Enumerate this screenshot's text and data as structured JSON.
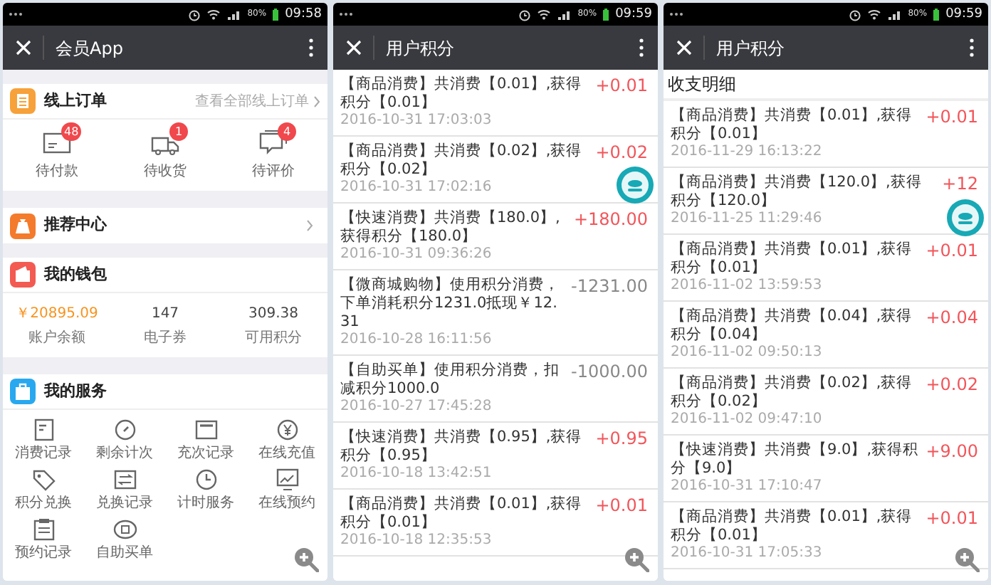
{
  "phones": [
    {
      "kind": "home",
      "status_bar": {
        "time": "09:58",
        "battery": "80%"
      },
      "title_bar": {
        "title": "会员App"
      },
      "orders": {
        "title": "线上订单",
        "link": "查看全部线上订单",
        "items": [
          {
            "label": "待付款",
            "badge": "48"
          },
          {
            "label": "待收货",
            "badge": "1"
          },
          {
            "label": "待评价",
            "badge": "4"
          }
        ]
      },
      "referral": {
        "title": "推荐中心"
      },
      "wallet": {
        "title": "我的钱包",
        "stats": [
          {
            "value": "￥20895.09",
            "label": "账户余额",
            "highlighted": true
          },
          {
            "value": "147",
            "label": "电子券",
            "highlighted": false
          },
          {
            "value": "309.38",
            "label": "可用积分",
            "highlighted": false
          }
        ]
      },
      "services": {
        "title": "我的服务",
        "items": [
          "消费记录",
          "剩余计次",
          "充次记录",
          "在线充值",
          "积分兑换",
          "兑换记录",
          "计时服务",
          "在线预约",
          "预约记录",
          "自助买单"
        ]
      }
    },
    {
      "kind": "points",
      "status_bar": {
        "time": "09:59",
        "battery": "80%"
      },
      "title_bar": {
        "title": "用户积分"
      },
      "entries": [
        {
          "kind": "credit",
          "text": "【商品消费】共消费【0.01】,获得积分【0.01】",
          "date": "2016-10-31 17:03:03",
          "amount": "+0.01"
        },
        {
          "kind": "credit",
          "text": "【商品消费】共消费【0.02】,获得积分【0.02】",
          "date": "2016-10-31 17:02:16",
          "amount": "+0.02"
        },
        {
          "kind": "credit",
          "text": "【快速消费】共消费【180.0】,获得积分【180.0】",
          "date": "2016-10-31 09:36:26",
          "amount": "+180.00"
        },
        {
          "kind": "debit",
          "text": "【微商城购物】使用积分消费，下单消耗积分1231.0抵现￥12.31",
          "date": "2016-10-28 16:11:56",
          "amount": "-1231.00"
        },
        {
          "kind": "debit",
          "text": "【自助买单】使用积分消费，扣减积分1000.0",
          "date": "2016-10-27 17:45:28",
          "amount": "-1000.00"
        },
        {
          "kind": "credit",
          "text": "【快速消费】共消费【0.95】,获得积分【0.95】",
          "date": "2016-10-18 13:42:51",
          "amount": "+0.95"
        },
        {
          "kind": "credit",
          "text": "【商品消费】共消费【0.01】,获得积分【0.01】",
          "date": "2016-10-18 12:35:53",
          "amount": "+0.01"
        }
      ]
    },
    {
      "kind": "points",
      "status_bar": {
        "time": "09:59",
        "battery": "80%"
      },
      "title_bar": {
        "title": "用户积分"
      },
      "header": "收支明细",
      "entries": [
        {
          "kind": "credit",
          "text": "【商品消费】共消费【0.01】,获得积分【0.01】",
          "date": "2016-11-29 16:13:22",
          "amount": "+0.01"
        },
        {
          "kind": "credit",
          "text": "【商品消费】共消费【120.0】,获得积分【120.0】",
          "date": "2016-11-25 11:29:46",
          "amount": "+12"
        },
        {
          "kind": "credit",
          "text": "【商品消费】共消费【0.01】,获得积分【0.01】",
          "date": "2016-11-02 13:59:53",
          "amount": "+0.01"
        },
        {
          "kind": "credit",
          "text": "【商品消费】共消费【0.04】,获得积分【0.04】",
          "date": "2016-11-02 09:50:13",
          "amount": "+0.04"
        },
        {
          "kind": "credit",
          "text": "【商品消费】共消费【0.02】,获得积分【0.02】",
          "date": "2016-11-02 09:47:10",
          "amount": "+0.02"
        },
        {
          "kind": "credit",
          "text": "【快速消费】共消费【9.0】,获得积分【9.0】",
          "date": "2016-10-31 17:10:47",
          "amount": "+9.00"
        },
        {
          "kind": "credit",
          "text": "【商品消费】共消费【0.01】,获得积分【0.01】",
          "date": "2016-10-31 17:05:33",
          "amount": "+0.01"
        }
      ]
    }
  ]
}
